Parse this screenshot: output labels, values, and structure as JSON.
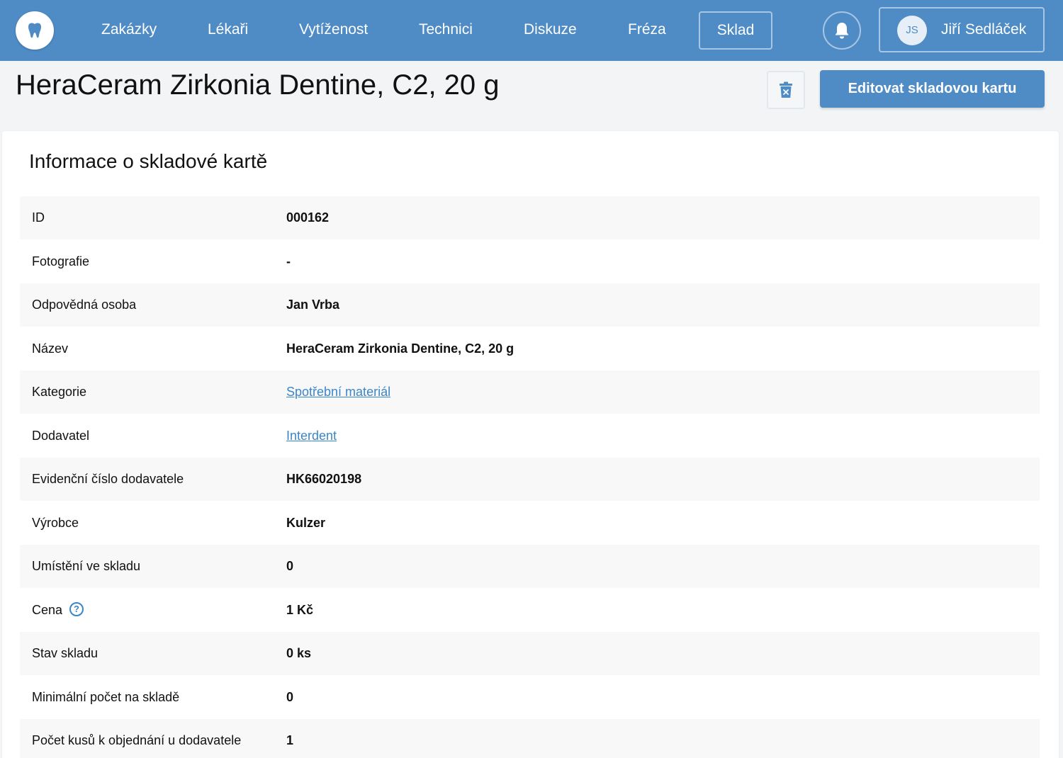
{
  "header": {
    "logo_icon": "tooth-icon",
    "nav": [
      {
        "label": "Zakázky"
      },
      {
        "label": "Lékaři"
      },
      {
        "label": "Vytíženost"
      },
      {
        "label": "Technici"
      },
      {
        "label": "Diskuze"
      },
      {
        "label": "Fréza"
      },
      {
        "label": "Sklad",
        "active": true
      }
    ],
    "bell_icon": "bell-icon",
    "user": {
      "initials": "JS",
      "name": "Jiří Sedláček"
    }
  },
  "page": {
    "title": "HeraCeram Zirkonia Dentine, C2, 20 g",
    "delete_icon": "trash-icon",
    "edit_label": "Editovat skladovou kartu"
  },
  "card": {
    "title": "Informace o skladové kartě",
    "rows": [
      {
        "label": "ID",
        "value": "000162"
      },
      {
        "label": "Fotografie",
        "value": "-"
      },
      {
        "label": "Odpovědná osoba",
        "value": "Jan Vrba"
      },
      {
        "label": "Název",
        "value": "HeraCeram Zirkonia Dentine, C2, 20 g"
      },
      {
        "label": "Kategorie",
        "value": "Spotřební materiál",
        "link": true
      },
      {
        "label": "Dodavatel",
        "value": "Interdent",
        "link": true
      },
      {
        "label": "Evidenční číslo dodavatele",
        "value": "HK66020198"
      },
      {
        "label": "Výrobce",
        "value": "Kulzer"
      },
      {
        "label": "Umístění ve skladu",
        "value": "0"
      },
      {
        "label": "Cena",
        "value": "1 Kč",
        "help_icon": "?"
      },
      {
        "label": "Stav skladu",
        "value": "0 ks"
      },
      {
        "label": "Minimální počet na skladě",
        "value": "0"
      },
      {
        "label": "Počet kusů k objednání u dodavatele",
        "value": "1"
      }
    ]
  },
  "colors": {
    "brand": "#4f8cc6",
    "link": "#3a86c8",
    "row_alt": "#f8f8f8",
    "page_bg": "#f2f4f5"
  }
}
